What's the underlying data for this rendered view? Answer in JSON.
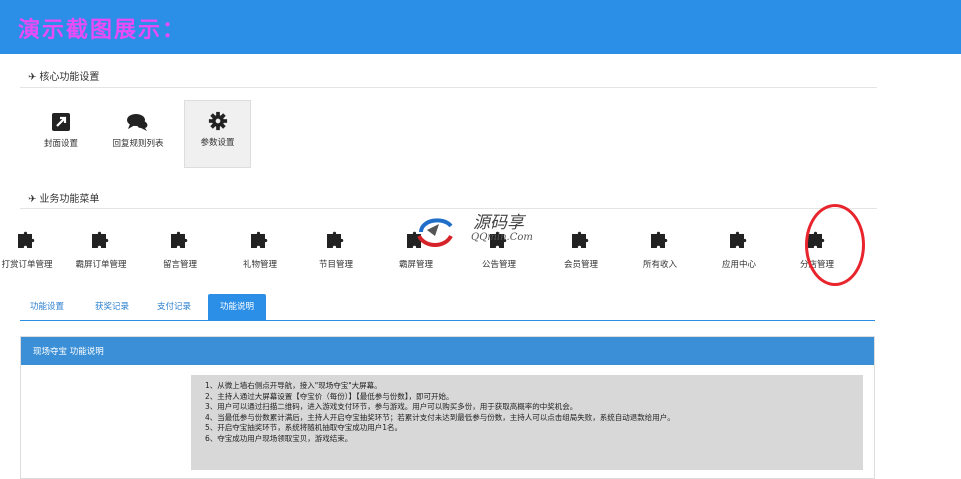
{
  "banner": {
    "title": "演示截图展示："
  },
  "core": {
    "heading": "核心功能设置",
    "items": [
      {
        "label": "封面设置",
        "icon": "external-link-icon"
      },
      {
        "label": "回复规则列表",
        "icon": "comments-icon"
      },
      {
        "label": "参数设置",
        "icon": "gear-icon",
        "active": true
      }
    ]
  },
  "business": {
    "heading": "业务功能菜单",
    "items": [
      {
        "label": "打赏订单管理",
        "icon": "puzzle-icon"
      },
      {
        "label": "霸屏订单管理",
        "icon": "puzzle-icon"
      },
      {
        "label": "留言管理",
        "icon": "puzzle-icon"
      },
      {
        "label": "礼物管理",
        "icon": "puzzle-icon"
      },
      {
        "label": "节目管理",
        "icon": "puzzle-icon"
      },
      {
        "label": "霸屏管理",
        "icon": "puzzle-icon"
      },
      {
        "label": "公告管理",
        "icon": "puzzle-icon"
      },
      {
        "label": "会员管理",
        "icon": "puzzle-icon"
      },
      {
        "label": "所有收入",
        "icon": "puzzle-icon"
      },
      {
        "label": "应用中心",
        "icon": "puzzle-icon"
      },
      {
        "label": "分店管理",
        "icon": "puzzle-icon",
        "highlighted": true
      }
    ]
  },
  "tabs": [
    {
      "label": "功能设置"
    },
    {
      "label": "获奖记录"
    },
    {
      "label": "支付记录"
    },
    {
      "label": "功能说明",
      "active": true
    }
  ],
  "panel": {
    "title": "现场夺宝 功能说明",
    "lines": [
      "1、从微上墙右侧点开导航，接入\"现场夺宝\"大屏幕。",
      "2、主持人通过大屏幕设置【夺宝价（每份）】【最低参与份数】，即可开始。",
      "3、用户可以通过扫描二维码，进入游戏支付环节，参与游戏。用户可以购买多份，用于获取高概率的中奖机会。",
      "4、当最低参与份数累计满后，主持人开启夺宝抽奖环节；若累计支付未达到最低参与份数，主持人可以点击组局失败，系统自动退款给用户。",
      "5、开启夺宝抽奖环节，系统将随机抽取夺宝成功用户1名。",
      "6、夺宝成功用户现场领取宝贝，游戏结束。"
    ]
  },
  "watermark": {
    "main": "源码享",
    "sub": "QQmin.Com"
  },
  "colors": {
    "banner": "#2b8fe8",
    "title": "#e74cf6",
    "highlight": "#e8242c"
  }
}
